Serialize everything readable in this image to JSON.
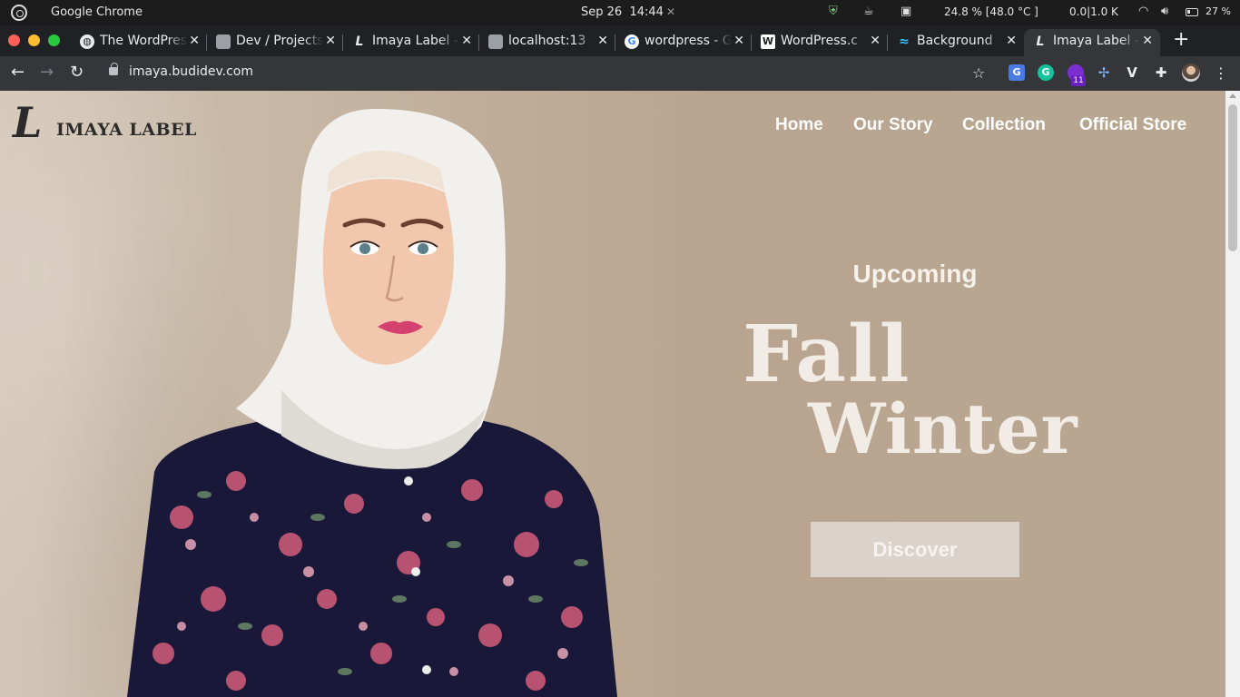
{
  "os_bar": {
    "app_name": "Google Chrome",
    "date": "Sep 26",
    "time": "14:44",
    "cpu_usage": "24.8 % [48.0 °C ]",
    "network": "0.0|1.0 K",
    "battery": "27 %"
  },
  "tabs": [
    {
      "title": "The WordPress",
      "favicon": "globe-icon",
      "active": false
    },
    {
      "title": "Dev / Projects",
      "favicon": "avatar-icon",
      "active": false
    },
    {
      "title": "Imaya Label -",
      "favicon": "imaya-logo-icon",
      "active": false
    },
    {
      "title": "localhost:13",
      "favicon": "avatar-icon",
      "active": false
    },
    {
      "title": "wordpress - G",
      "favicon": "google-icon",
      "active": false
    },
    {
      "title": "WordPress.c",
      "favicon": "wordpress-icon",
      "active": false
    },
    {
      "title": "Background",
      "favicon": "tailwind-icon",
      "active": false
    },
    {
      "title": "Imaya Label -",
      "favicon": "imaya-logo-icon",
      "active": true
    }
  ],
  "toolbar": {
    "url": "imaya.budidev.com",
    "extension_badge": "11"
  },
  "site": {
    "brand_mark": "L",
    "brand_name": "IMAYA LABEL",
    "menu": [
      "Home",
      "Our Story",
      "Collection",
      "Official Store"
    ],
    "hero": {
      "subtitle": "Upcoming",
      "title_line_1": "Fall",
      "title_line_2": "Winter",
      "cta_label": "Discover"
    }
  },
  "colors": {
    "hero_bg": "#b9a58f",
    "cta_bg": "#dbd2cb",
    "chrome_dark": "#202124",
    "chrome_toolbar": "#35363a"
  }
}
